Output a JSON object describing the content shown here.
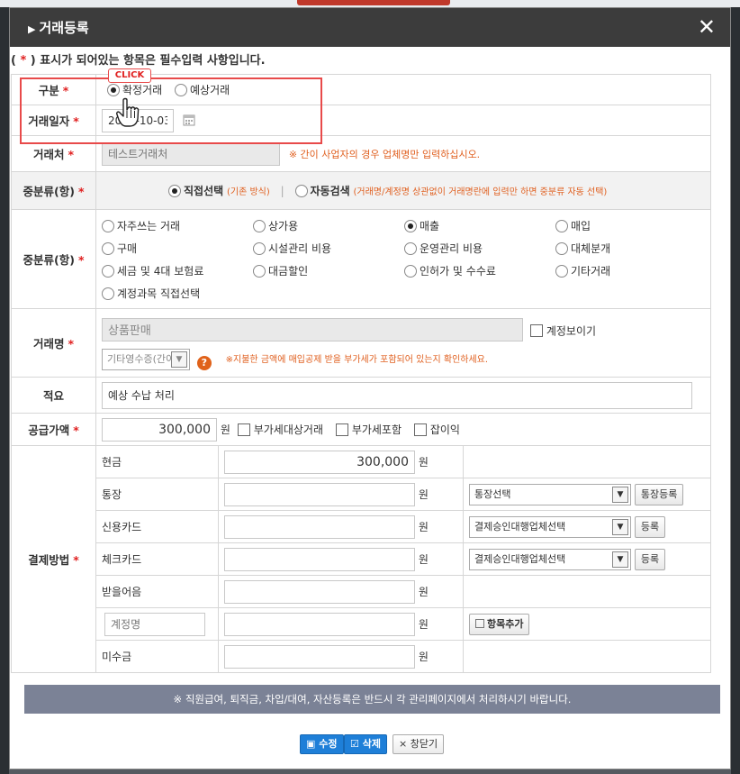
{
  "window": {
    "title": "거래등록",
    "close_label": "✕"
  },
  "notice": {
    "prefix": "( ",
    "star": "*",
    "suffix": " ) 표시가 되어있는 항목은 필수입력 사항입니다."
  },
  "click_label": "CLICK",
  "labels": {
    "gubun": "구분",
    "date": "거래일자",
    "partner": "거래처",
    "category_mode": "중분류(항)",
    "category": "중분류(항)",
    "txn_name": "거래명",
    "memo": "적요",
    "amount": "공급가액",
    "payment": "결제방법",
    "required_mark": "*"
  },
  "gubun": {
    "options": [
      "확정거래",
      "예상거래"
    ],
    "selected": "확정거래"
  },
  "date": {
    "value": "2016-10-03"
  },
  "partner": {
    "placeholder": "테스트거래처",
    "hint": "※ 간이 사업자의 경우 업체명만 입력하십시오."
  },
  "category_mode": {
    "opt1": "직접선택",
    "opt1_note": "(기존 방식)",
    "sep": "|",
    "opt2": "자동검색",
    "opt2_note": "(거래명/계정명 상관없이 거래명란에 입력만 하면 중분류 자동 선택)",
    "selected": "직접선택"
  },
  "category": {
    "options": [
      "자주쓰는 거래",
      "상가용",
      "매출",
      "매입",
      "구매",
      "시설관리 비용",
      "운영관리 비용",
      "대체분개",
      "세금 및 4대 보험료",
      "대금할인",
      "인허가 및 수수료",
      "기타거래",
      "계정과목 직접선택"
    ],
    "selected": "매출"
  },
  "txn_name": {
    "value": "상품판매",
    "show_account_label": "계정보이기",
    "tax_select": "기타영수증(간이",
    "help_icon": "question-icon",
    "hint": "※지불한 금액에 매입공제 받을 부가세가 포함되어 있는지 확인하세요."
  },
  "memo": {
    "value": "예상 수납 처리"
  },
  "amount": {
    "value": "300,000",
    "unit": "원",
    "checks": [
      "부가세대상거래",
      "부가세포함",
      "잡이익"
    ]
  },
  "payment": {
    "unit": "원",
    "rows": [
      {
        "label": "현금",
        "value": "300,000",
        "select": "",
        "button": ""
      },
      {
        "label": "통장",
        "value": "",
        "select": "통장선택",
        "button": "통장등록"
      },
      {
        "label": "신용카드",
        "value": "",
        "select": "결제승인대행업체선택",
        "button": "등록"
      },
      {
        "label": "체크카드",
        "value": "",
        "select": "결제승인대행업체선택",
        "button": "등록"
      },
      {
        "label": "받을어음",
        "value": "",
        "select": "",
        "button": ""
      },
      {
        "label": "",
        "value": "",
        "select": "",
        "button": "항목추가",
        "placeholder": "계정명"
      },
      {
        "label": "미수금",
        "value": "",
        "select": "",
        "button": ""
      }
    ]
  },
  "footer_notice": "※ 직원급여, 퇴직금, 차입/대여, 자산등록은 반드시 각 관리페이지에서 처리하시기 바랍니다.",
  "actions": {
    "edit": "수정",
    "delete": "삭제",
    "close": "창닫기"
  },
  "colors": {
    "header": "#3c3c3c",
    "required": "#e02020",
    "hint": "#e06020",
    "highlight": "#e84a4a",
    "footer": "#7b8296",
    "primary": "#1e7fd8"
  }
}
